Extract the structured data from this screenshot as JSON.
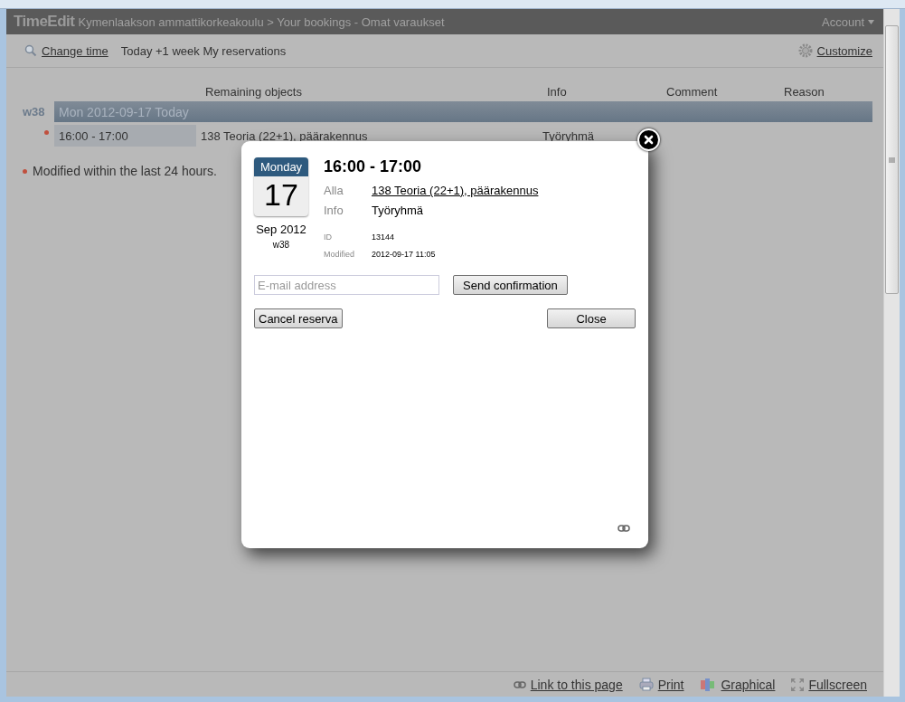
{
  "header": {
    "logo": "TimeEdit",
    "breadcrumb": "Kymenlaakson ammattikorkeakoulu > Your bookings - Omat varaukset",
    "account": "Account"
  },
  "toolbar": {
    "change_time": "Change time",
    "period": "Today +1 week My reservations",
    "customize": "Customize"
  },
  "table": {
    "columns": [
      "Remaining objects",
      "Info",
      "Comment",
      "Reason"
    ],
    "days": [
      {
        "week": "w38",
        "date": "Mon 2012-09-17 Today",
        "rows": [
          {
            "modified": true,
            "time": "16:00 - 17:00",
            "object": "138 Teoria (22+1), päärakennus",
            "info": "Työryhmä"
          }
        ]
      }
    ]
  },
  "legend": "Modified within the last 24 hours.",
  "dialog": {
    "weekday": "Monday",
    "day": "17",
    "month": "Sep 2012",
    "week": "w38",
    "time": "16:00 - 17:00",
    "fields": [
      {
        "label": "Alla",
        "value": "138 Teoria (22+1), päärakennus",
        "kind": "link"
      },
      {
        "label": "Info",
        "value": "Työryhmä",
        "kind": "text"
      },
      {
        "label": "ID",
        "value": "13144",
        "kind": "small"
      },
      {
        "label": "Modified",
        "value": "2012-09-17 11:05",
        "kind": "small"
      }
    ],
    "email": {
      "placeholder": "E-mail address"
    },
    "send": "Send confirmation",
    "cancel": "Cancel reserva",
    "close": "Close"
  },
  "footer": [
    {
      "label": "Link to this page",
      "kind": "link"
    },
    {
      "label": "Print",
      "kind": "print"
    },
    {
      "label": "Graphical",
      "kind": "graphical"
    },
    {
      "label": "Fullscreen",
      "kind": "fullscreen"
    }
  ]
}
